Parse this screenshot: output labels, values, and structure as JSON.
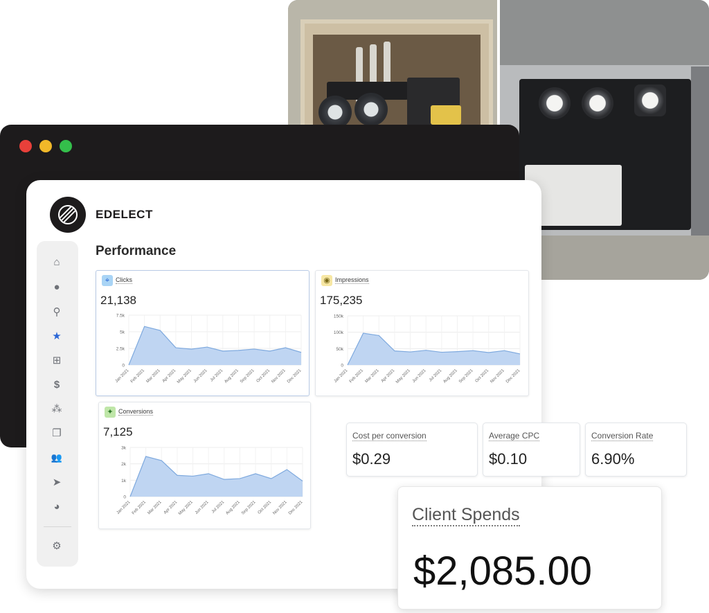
{
  "window": {
    "controls": [
      "close",
      "minimize",
      "maximize"
    ]
  },
  "app": {
    "brand": "EDELECT",
    "section_title": "Performance"
  },
  "sidebar": {
    "items": [
      {
        "icon": "home-icon",
        "glyph": "⌂"
      },
      {
        "icon": "chat-icon",
        "glyph": "●"
      },
      {
        "icon": "map-pin-icon",
        "glyph": "⚲"
      },
      {
        "icon": "star-icon",
        "glyph": "★",
        "active": true
      },
      {
        "icon": "grid-icon",
        "glyph": "⊞"
      },
      {
        "icon": "dollar-icon",
        "glyph": "$"
      },
      {
        "icon": "network-icon",
        "glyph": "⁂"
      },
      {
        "icon": "copy-icon",
        "glyph": "❐"
      },
      {
        "icon": "users-icon",
        "glyph": "👥"
      },
      {
        "icon": "send-icon",
        "glyph": "➤"
      },
      {
        "icon": "pie-chart-icon",
        "glyph": "◕"
      },
      {
        "icon": "settings-icon",
        "glyph": "⚙"
      }
    ],
    "active_color": "#2a66d6"
  },
  "metrics": {
    "clicks": {
      "label": "Clicks",
      "value": "21,138",
      "icon": "cursor-click-icon",
      "badge_color": "#a9d4f5"
    },
    "impressions": {
      "label": "Impressions",
      "value": "175,235",
      "icon": "eye-icon",
      "badge_color": "#f7e7a4"
    },
    "conversions": {
      "label": "Conversions",
      "value": "7,125",
      "icon": "lightbulb-icon",
      "badge_color": "#bfe6a8"
    }
  },
  "stats": {
    "cost_per_conversion": {
      "label": "Cost per conversion",
      "value": "$0.29"
    },
    "average_cpc": {
      "label": "Average CPC",
      "value": "$0.10"
    },
    "conversion_rate": {
      "label": "Conversion Rate",
      "value": "6.90%"
    }
  },
  "client_spends": {
    "label": "Client Spends",
    "value": "$2,085.00"
  },
  "chart_data": [
    {
      "type": "area",
      "categories": [
        "Jan 2021",
        "Feb 2021",
        "Mar 2021",
        "Apr 2021",
        "May 2021",
        "Jun 2021",
        "Jul 2021",
        "Aug 2021",
        "Sep 2021",
        "Oct 2021",
        "Nov 2021",
        "Dec 2021"
      ],
      "values": [
        0,
        5800,
        5200,
        2600,
        2400,
        2700,
        2100,
        2200,
        2400,
        2100,
        2600,
        1900
      ],
      "yticks": [
        "0",
        "2.5k",
        "5k",
        "7.5k"
      ],
      "ylim": [
        0,
        7500
      ],
      "series_color": "#7ea9de"
    },
    {
      "type": "area",
      "categories": [
        "Jan 2021",
        "Feb 2021",
        "Mar 2021",
        "Apr 2021",
        "May 2021",
        "Jun 2021",
        "Jul 2021",
        "Aug 2021",
        "Sep 2021",
        "Oct 2021",
        "Nov 2021",
        "Dec 2021"
      ],
      "values": [
        0,
        97000,
        90000,
        43000,
        40000,
        45000,
        39000,
        41000,
        44000,
        38000,
        44000,
        34000
      ],
      "yticks": [
        "0",
        "50k",
        "100k",
        "150k"
      ],
      "ylim": [
        0,
        150000
      ],
      "series_color": "#7ea9de"
    },
    {
      "type": "area",
      "categories": [
        "Jan 2021",
        "Feb 2021",
        "Mar 2021",
        "Apr 2021",
        "May 2021",
        "Jun 2021",
        "Jul 2021",
        "Aug 2021",
        "Sep 2021",
        "Oct 2021",
        "Nov 2021",
        "Dec 2021"
      ],
      "values": [
        0,
        2450,
        2200,
        1300,
        1250,
        1400,
        1050,
        1100,
        1400,
        1100,
        1650,
        950
      ],
      "yticks": [
        "0",
        "1k",
        "2k",
        "3k"
      ],
      "ylim": [
        0,
        3000
      ],
      "series_color": "#7ea9de"
    }
  ]
}
